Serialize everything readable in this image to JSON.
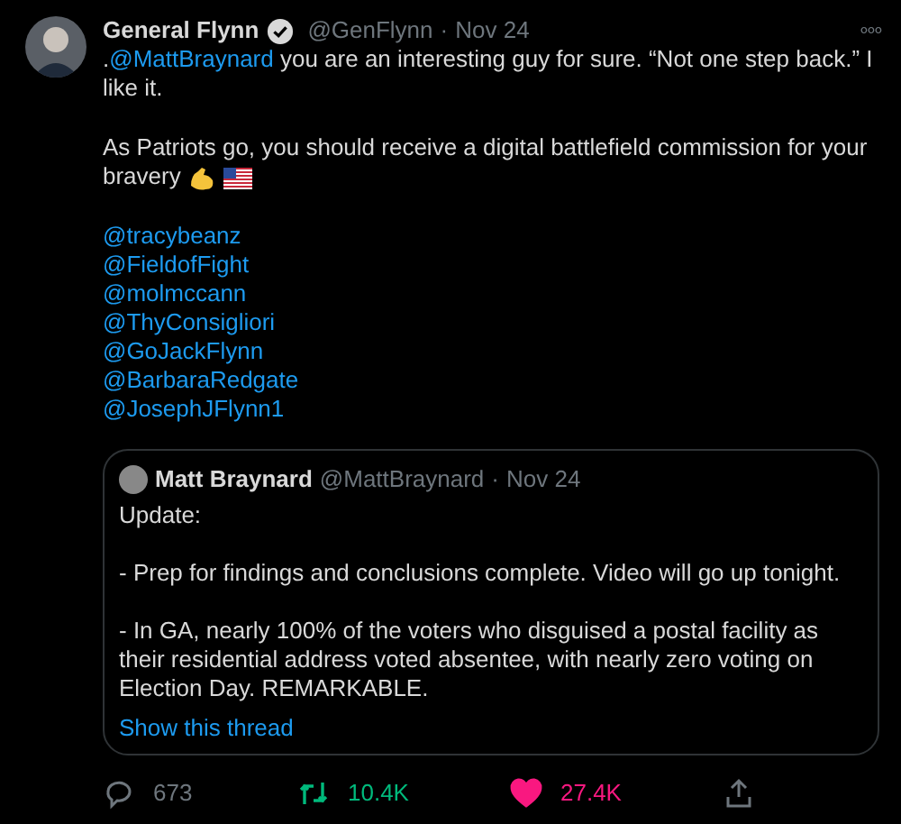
{
  "tweet": {
    "author": {
      "name": "General Flynn",
      "verified": true,
      "handle": "@GenFlynn",
      "separator": "·",
      "date": "Nov 24"
    },
    "more": "∘∘∘",
    "paragraphs": [
      {
        "before": ".",
        "mention": "@MattBraynard",
        "after": " you are an interesting guy for sure. “Not one step back.” I like it."
      },
      {
        "before": "As Patriots go, you should receive a digital battlefield commission for your bravery"
      }
    ],
    "mentions": [
      "@tracybeanz",
      "@FieldofFight",
      "@molmccann",
      "@ThyConsigliori",
      "@GoJackFlynn",
      "@BarbaraRedgate",
      "@JosephJFlynn1"
    ],
    "quoted": {
      "name": "Matt Braynard",
      "handle": "@MattBraynard",
      "separator": "·",
      "date": "Nov 24",
      "paragraphs": [
        "Update:",
        "- Prep for findings and conclusions complete. Video will go up tonight.",
        "- In GA, nearly 100% of the voters who disguised a postal facility as their residential address voted absentee, with nearly zero voting on Election Day. REMARKABLE."
      ],
      "thread_link": "Show this thread"
    },
    "actions": [
      {
        "kind": "reply",
        "count": "673",
        "selected": false
      },
      {
        "kind": "retweet",
        "count": "10.4K",
        "selected": true
      },
      {
        "kind": "like",
        "count": "27.4K",
        "selected": true
      },
      {
        "kind": "share"
      }
    ]
  }
}
